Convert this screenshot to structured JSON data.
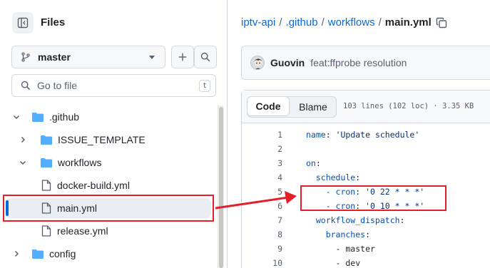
{
  "sidebar": {
    "title": "Files",
    "branch": "master",
    "goto_placeholder": "Go to file",
    "goto_shortcut": "t",
    "tree": [
      {
        "label": ".github",
        "type": "folder",
        "expanded": true
      },
      {
        "label": "ISSUE_TEMPLATE",
        "type": "folder",
        "expanded": false
      },
      {
        "label": "workflows",
        "type": "folder",
        "expanded": true
      },
      {
        "label": "docker-build.yml",
        "type": "file"
      },
      {
        "label": "main.yml",
        "type": "file",
        "active": true
      },
      {
        "label": "release.yml",
        "type": "file"
      },
      {
        "label": "config",
        "type": "folder",
        "expanded": false
      }
    ]
  },
  "breadcrumb": {
    "repo": "iptv-api",
    "sep": "/",
    "dir1": ".github",
    "dir2": "workflows",
    "current": "main.yml"
  },
  "commit": {
    "author": "Guovin",
    "message": "feat:ffprobe resolution"
  },
  "code_view": {
    "tab_code": "Code",
    "tab_blame": "Blame",
    "meta": "103 lines (102 loc) · 3.35 KB",
    "lines": [
      {
        "n": "1",
        "key": "name",
        "colon": ": ",
        "val": "'Update schedule'"
      },
      {
        "n": "2",
        "key": "",
        "colon": "",
        "val": ""
      },
      {
        "n": "3",
        "key": "on",
        "colon": ":",
        "val": ""
      },
      {
        "n": "4",
        "key": "  schedule",
        "colon": ":",
        "val": ""
      },
      {
        "n": "5",
        "key": "    - cron",
        "colon": ": ",
        "val": "'0 22 * * *'"
      },
      {
        "n": "6",
        "key": "    - cron",
        "colon": ": ",
        "val": "'0 10 * * *'"
      },
      {
        "n": "7",
        "key": "  workflow_dispatch",
        "colon": ":",
        "val": ""
      },
      {
        "n": "8",
        "key": "    branches",
        "colon": ":",
        "val": ""
      },
      {
        "n": "9",
        "key": "      - master",
        "colon": "",
        "val": ""
      },
      {
        "n": "10",
        "key": "      - dev",
        "colon": "",
        "val": ""
      }
    ]
  },
  "colors": {
    "link": "#0969da",
    "annotation": "#e3202a",
    "folder": "#54aeff"
  },
  "icons": {
    "panel": "sidebar-collapse-icon",
    "branch": "git-branch-icon",
    "add": "plus-icon",
    "search": "search-icon",
    "folder": "folder-icon",
    "file": "file-icon",
    "copy": "copy-icon",
    "chevron_down": "chevron-down-icon",
    "chevron_right": "chevron-right-icon"
  }
}
